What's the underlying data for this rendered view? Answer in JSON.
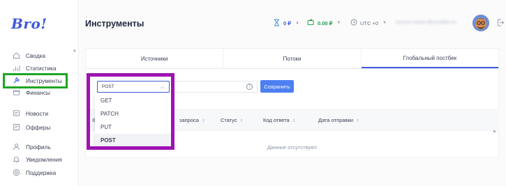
{
  "app": {
    "logo": "Bro!"
  },
  "sidebar": {
    "items": [
      {
        "label": "Сводка",
        "icon": "home-icon"
      },
      {
        "label": "Статистика",
        "icon": "bar-chart-icon"
      },
      {
        "label": "Инструменты",
        "icon": "wrench-icon",
        "active": true
      },
      {
        "label": "Финансы",
        "icon": "wallet-icon"
      },
      {
        "label": "Новости",
        "icon": "news-icon"
      },
      {
        "label": "Офферы",
        "icon": "offers-icon"
      },
      {
        "label": "Профиль",
        "icon": "user-icon"
      },
      {
        "label": "Уведомления",
        "icon": "bell-icon"
      },
      {
        "label": "Поддержка",
        "icon": "support-icon"
      }
    ]
  },
  "header": {
    "title": "Инструменты",
    "hold_balance": "0 ₽",
    "balance": "0.00 ₽",
    "timezone": "UTC +0",
    "email": "ivanov.maxim@rambler.ru"
  },
  "tabs": [
    {
      "label": "Источники"
    },
    {
      "label": "Потоки"
    },
    {
      "label": "Глобальный постбек",
      "active": true
    }
  ],
  "form": {
    "method_value": "POST",
    "save_label": "Сохранить",
    "help_glyph": "?"
  },
  "table": {
    "columns": [
      "ID",
      "запроса",
      "Статус",
      "Код ответа",
      "Дата отправки"
    ],
    "empty_text": "Данные отсутствуют"
  },
  "dropdown": {
    "options": [
      "GET",
      "PATCH",
      "PUT",
      "POST"
    ],
    "selected": "POST"
  },
  "colors": {
    "accent": "#3f5bd8",
    "button": "#4c7ff1",
    "balance_green": "#21a04b",
    "highlight_green": "#1ea524",
    "highlight_purple": "#9e13b2"
  }
}
